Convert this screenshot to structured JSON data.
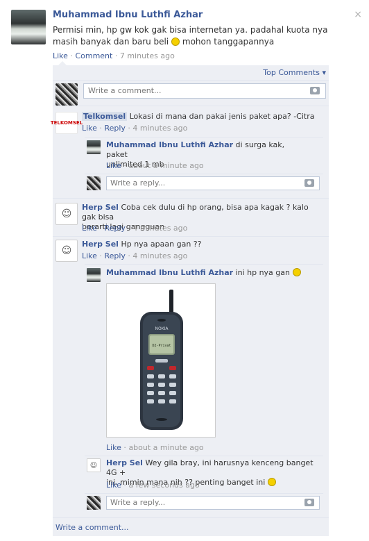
{
  "post": {
    "author": "Muhammad Ibnu Luthfi Azhar",
    "text_line1": "Permisi min, hp gw kok gak bisa internetan ya. padahal kuota nya",
    "text_line2": "masih banyak dan baru beli",
    "text_line2_end": "mohon tanggapannya",
    "like": "Like",
    "comment": "Comment",
    "time": "7 minutes ago",
    "close": "×"
  },
  "comments_panel": {
    "top_comments": "Top Comments ▾",
    "write_comment_placeholder": "Write a comment...",
    "write_comment_link": "Write a comment..."
  },
  "comments": [
    {
      "author": "Telkomsel",
      "text": "Lokasi di mana dan pakai jenis paket apa? -Citra",
      "like": "Like",
      "reply": "Reply",
      "time": "4 minutes ago",
      "avatar_text": "TELKOMSEL",
      "replies": [
        {
          "author": "Muhammad Ibnu Luthfi Azhar",
          "text_line1": "di surga kak, paket",
          "text_line2": "unlimited 1 mb",
          "like": "Like",
          "time": "about a minute ago"
        }
      ],
      "reply_placeholder": "Write a reply..."
    },
    {
      "author": "Herp Sel",
      "text_line1": "Coba cek dulu di hp orang, bisa apa kagak ? kalo gak bisa",
      "text_line2": "berarti lagi gangguan",
      "like": "Like",
      "reply": "Reply",
      "time": "4 minutes ago"
    },
    {
      "author": "Herp Sel",
      "text": "Hp nya apaan gan ??",
      "like": "Like",
      "reply": "Reply",
      "time": "4 minutes ago",
      "replies": [
        {
          "author": "Muhammad Ibnu Luthfi Azhar",
          "text": "ini hp nya gan",
          "like": "Like",
          "time": "about a minute ago",
          "phone_brand": "NOKIA",
          "phone_screen": "D2-Privat"
        },
        {
          "author": "Herp Sel",
          "text_line1": "Wey gila bray, ini harusnya kenceng banget 4G +",
          "text_line2": "ini. mimin mana nih ?? penting banget ini",
          "like": "Like",
          "time": "a few seconds ago"
        }
      ],
      "reply_placeholder": "Write a reply..."
    }
  ],
  "colors": {
    "link": "#3b5998",
    "panel_bg": "#edeff4",
    "meta_gray": "#999999"
  }
}
